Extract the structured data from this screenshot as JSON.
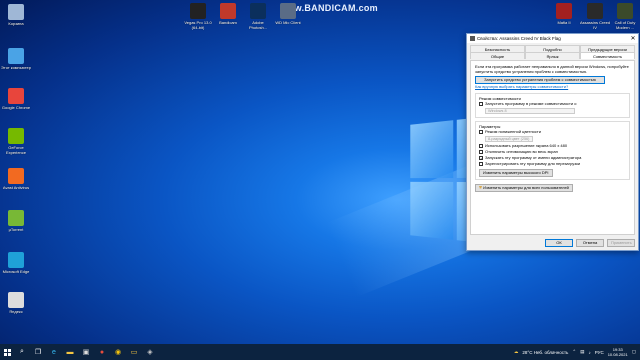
{
  "desktop": {
    "watermark": "www.BANDICAM.com",
    "left_icons": [
      {
        "label": "Корзина",
        "icon": "recycle-bin-icon",
        "color": "#9fb7d6"
      },
      {
        "label": "Этот компьютер",
        "icon": "computer-icon",
        "color": "#4aa3e6"
      },
      {
        "label": "Google Chrome",
        "icon": "chrome-icon",
        "color": "#e8453c"
      },
      {
        "label": "GeForce Experience",
        "icon": "geforce-icon",
        "color": "#76b900"
      },
      {
        "label": "Avast Antivirus",
        "icon": "avast-icon",
        "color": "#f26a21"
      },
      {
        "label": "µTorrent",
        "icon": "utorrent-icon",
        "color": "#78b836"
      },
      {
        "label": "Microsoft Edge",
        "icon": "edge-icon",
        "color": "#1fa1d8"
      },
      {
        "label": "Яндекс",
        "icon": "document-icon",
        "color": "#dddddd"
      }
    ],
    "top_icons": [
      {
        "label": "Vegas Pro 13.0 (64-bit)",
        "icon": "vegas-icon",
        "color": "#222222"
      },
      {
        "label": "Bandicam",
        "icon": "bandicam-icon",
        "color": "#c0392b"
      },
      {
        "label": "Adobe Photosh...",
        "icon": "photoshop-icon",
        "color": "#0b2f5c"
      },
      {
        "label": "WD Mic Client",
        "icon": "mic-icon",
        "color": "#5a6c86"
      }
    ],
    "right_icons": [
      {
        "label": "Mafia II",
        "icon": "mafia-icon",
        "color": "#a32020"
      },
      {
        "label": "Assassins Creed IV",
        "icon": "assassins-icon",
        "color": "#2a2a2a"
      },
      {
        "label": "Call of Duty Modern ...",
        "icon": "cod-icon",
        "color": "#3b4a2a"
      }
    ]
  },
  "dialog": {
    "title": "Свойства: Assassins Creed IV Black Flag",
    "tabs_row1": [
      "Безопасность",
      "Подробно",
      "Предыдущие версии"
    ],
    "tabs_row2": [
      "Общие",
      "Ярлык",
      "Совместимость"
    ],
    "intro": "Если эта программа работает неправильно в данной версии Windows, попробуйте запустить средство устранения проблем с совместимостью.",
    "troubleshoot_button": "Запустить средство устранения проблем с совместимостью",
    "manual_link": "Как вручную выбрать параметры совместимости?",
    "compat_group": "Режим совместимости",
    "compat_checkbox": "Запустить программу в режиме совместимости с:",
    "compat_os": "Windows 8",
    "params_group": "Параметры",
    "params": [
      {
        "label": "Режим пониженной цветности",
        "checked": false
      },
      {
        "label": "Использовать разрешение экрана 640 x 480",
        "checked": false
      },
      {
        "label": "Отключить оптимизацию во весь экран",
        "checked": false
      },
      {
        "label": "Запускать эту программу от имени администратора",
        "checked": true
      },
      {
        "label": "Зарегистрировать эту программу для перезагрузки",
        "checked": false
      }
    ],
    "color_combo": "8-разрядный цвет (256)",
    "dpi_button": "Изменить параметры высокого DPI",
    "all_users_button": "Изменить параметры для всех пользователей",
    "ok": "ОК",
    "cancel": "Отмена",
    "apply": "Применить"
  },
  "taskbar": {
    "weather": "28°C  Неб. облачность",
    "lang": "РУС",
    "time": "19:33",
    "date": "10.08.2021"
  }
}
